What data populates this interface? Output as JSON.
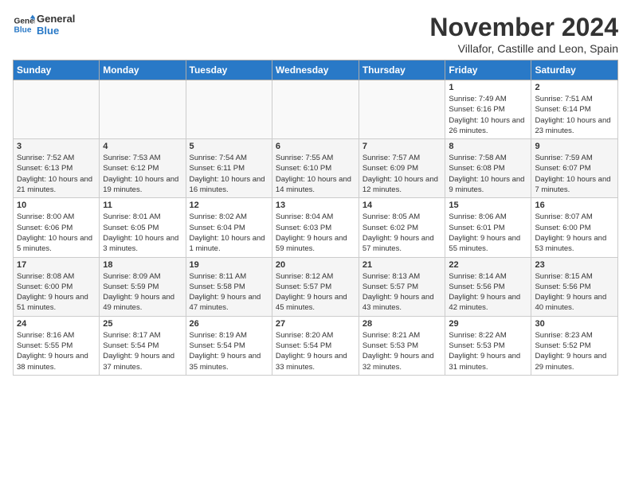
{
  "logo": {
    "line1": "General",
    "line2": "Blue"
  },
  "header": {
    "month": "November 2024",
    "location": "Villafor, Castille and Leon, Spain"
  },
  "weekdays": [
    "Sunday",
    "Monday",
    "Tuesday",
    "Wednesday",
    "Thursday",
    "Friday",
    "Saturday"
  ],
  "weeks": [
    [
      {
        "day": "",
        "info": ""
      },
      {
        "day": "",
        "info": ""
      },
      {
        "day": "",
        "info": ""
      },
      {
        "day": "",
        "info": ""
      },
      {
        "day": "",
        "info": ""
      },
      {
        "day": "1",
        "info": "Sunrise: 7:49 AM\nSunset: 6:16 PM\nDaylight: 10 hours and 26 minutes."
      },
      {
        "day": "2",
        "info": "Sunrise: 7:51 AM\nSunset: 6:14 PM\nDaylight: 10 hours and 23 minutes."
      }
    ],
    [
      {
        "day": "3",
        "info": "Sunrise: 7:52 AM\nSunset: 6:13 PM\nDaylight: 10 hours and 21 minutes."
      },
      {
        "day": "4",
        "info": "Sunrise: 7:53 AM\nSunset: 6:12 PM\nDaylight: 10 hours and 19 minutes."
      },
      {
        "day": "5",
        "info": "Sunrise: 7:54 AM\nSunset: 6:11 PM\nDaylight: 10 hours and 16 minutes."
      },
      {
        "day": "6",
        "info": "Sunrise: 7:55 AM\nSunset: 6:10 PM\nDaylight: 10 hours and 14 minutes."
      },
      {
        "day": "7",
        "info": "Sunrise: 7:57 AM\nSunset: 6:09 PM\nDaylight: 10 hours and 12 minutes."
      },
      {
        "day": "8",
        "info": "Sunrise: 7:58 AM\nSunset: 6:08 PM\nDaylight: 10 hours and 9 minutes."
      },
      {
        "day": "9",
        "info": "Sunrise: 7:59 AM\nSunset: 6:07 PM\nDaylight: 10 hours and 7 minutes."
      }
    ],
    [
      {
        "day": "10",
        "info": "Sunrise: 8:00 AM\nSunset: 6:06 PM\nDaylight: 10 hours and 5 minutes."
      },
      {
        "day": "11",
        "info": "Sunrise: 8:01 AM\nSunset: 6:05 PM\nDaylight: 10 hours and 3 minutes."
      },
      {
        "day": "12",
        "info": "Sunrise: 8:02 AM\nSunset: 6:04 PM\nDaylight: 10 hours and 1 minute."
      },
      {
        "day": "13",
        "info": "Sunrise: 8:04 AM\nSunset: 6:03 PM\nDaylight: 9 hours and 59 minutes."
      },
      {
        "day": "14",
        "info": "Sunrise: 8:05 AM\nSunset: 6:02 PM\nDaylight: 9 hours and 57 minutes."
      },
      {
        "day": "15",
        "info": "Sunrise: 8:06 AM\nSunset: 6:01 PM\nDaylight: 9 hours and 55 minutes."
      },
      {
        "day": "16",
        "info": "Sunrise: 8:07 AM\nSunset: 6:00 PM\nDaylight: 9 hours and 53 minutes."
      }
    ],
    [
      {
        "day": "17",
        "info": "Sunrise: 8:08 AM\nSunset: 6:00 PM\nDaylight: 9 hours and 51 minutes."
      },
      {
        "day": "18",
        "info": "Sunrise: 8:09 AM\nSunset: 5:59 PM\nDaylight: 9 hours and 49 minutes."
      },
      {
        "day": "19",
        "info": "Sunrise: 8:11 AM\nSunset: 5:58 PM\nDaylight: 9 hours and 47 minutes."
      },
      {
        "day": "20",
        "info": "Sunrise: 8:12 AM\nSunset: 5:57 PM\nDaylight: 9 hours and 45 minutes."
      },
      {
        "day": "21",
        "info": "Sunrise: 8:13 AM\nSunset: 5:57 PM\nDaylight: 9 hours and 43 minutes."
      },
      {
        "day": "22",
        "info": "Sunrise: 8:14 AM\nSunset: 5:56 PM\nDaylight: 9 hours and 42 minutes."
      },
      {
        "day": "23",
        "info": "Sunrise: 8:15 AM\nSunset: 5:56 PM\nDaylight: 9 hours and 40 minutes."
      }
    ],
    [
      {
        "day": "24",
        "info": "Sunrise: 8:16 AM\nSunset: 5:55 PM\nDaylight: 9 hours and 38 minutes."
      },
      {
        "day": "25",
        "info": "Sunrise: 8:17 AM\nSunset: 5:54 PM\nDaylight: 9 hours and 37 minutes."
      },
      {
        "day": "26",
        "info": "Sunrise: 8:19 AM\nSunset: 5:54 PM\nDaylight: 9 hours and 35 minutes."
      },
      {
        "day": "27",
        "info": "Sunrise: 8:20 AM\nSunset: 5:54 PM\nDaylight: 9 hours and 33 minutes."
      },
      {
        "day": "28",
        "info": "Sunrise: 8:21 AM\nSunset: 5:53 PM\nDaylight: 9 hours and 32 minutes."
      },
      {
        "day": "29",
        "info": "Sunrise: 8:22 AM\nSunset: 5:53 PM\nDaylight: 9 hours and 31 minutes."
      },
      {
        "day": "30",
        "info": "Sunrise: 8:23 AM\nSunset: 5:52 PM\nDaylight: 9 hours and 29 minutes."
      }
    ]
  ]
}
